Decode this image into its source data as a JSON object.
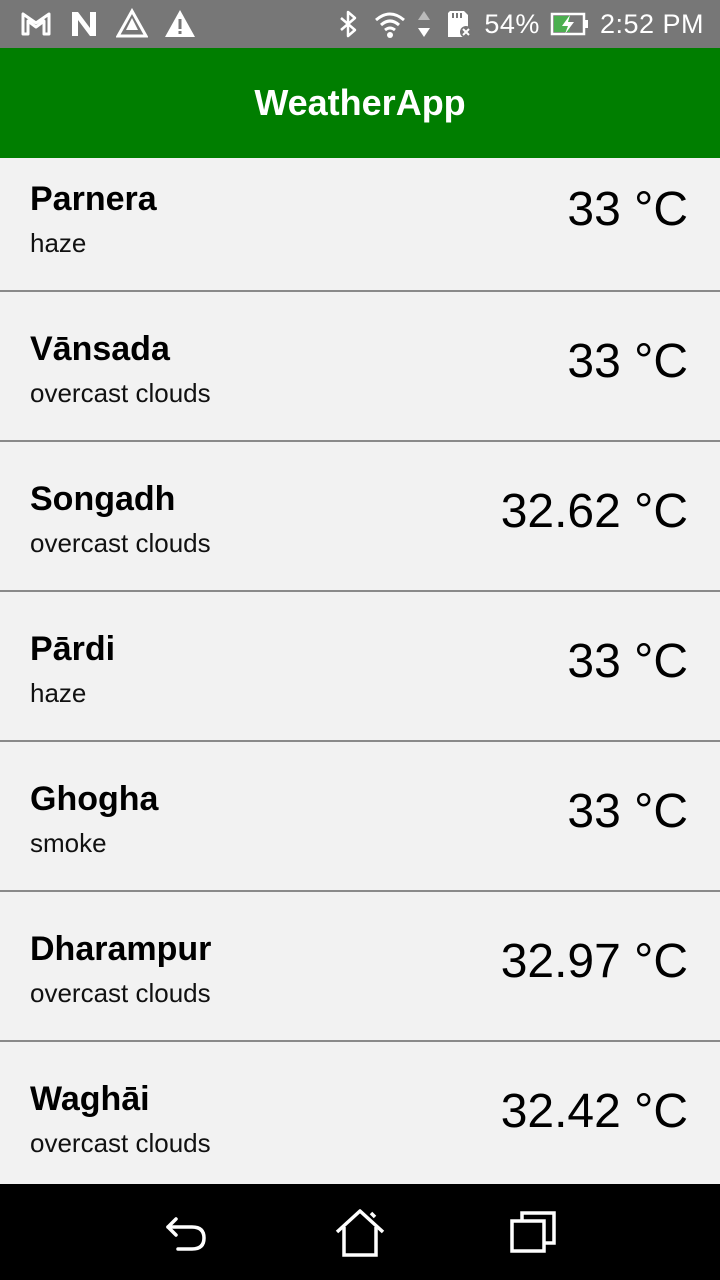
{
  "status_bar": {
    "left_icons": [
      "gmail-icon",
      "n-app-icon",
      "drive-alert-icon",
      "warning-icon"
    ],
    "right_icons": [
      "bluetooth-icon",
      "wifi-icon",
      "data-arrows-icon",
      "sd-card-icon"
    ],
    "battery_percent": "54%",
    "time": "2:52 PM"
  },
  "app_bar": {
    "title": "WeatherApp",
    "color": "#007e00"
  },
  "weather_list": [
    {
      "city": "Parnera",
      "description": "haze",
      "temperature": "33 °C"
    },
    {
      "city": "Vānsada",
      "description": "overcast clouds",
      "temperature": "33 °C"
    },
    {
      "city": "Songadh",
      "description": "overcast clouds",
      "temperature": "32.62 °C"
    },
    {
      "city": "Pārdi",
      "description": "haze",
      "temperature": "33 °C"
    },
    {
      "city": "Ghogha",
      "description": "smoke",
      "temperature": "33 °C"
    },
    {
      "city": "Dharampur",
      "description": "overcast clouds",
      "temperature": "32.97 °C"
    },
    {
      "city": "Waghāi",
      "description": "overcast clouds",
      "temperature": "32.42 °C"
    }
  ],
  "nav_bar": {
    "buttons": [
      "back-icon",
      "home-icon",
      "recents-icon"
    ]
  }
}
